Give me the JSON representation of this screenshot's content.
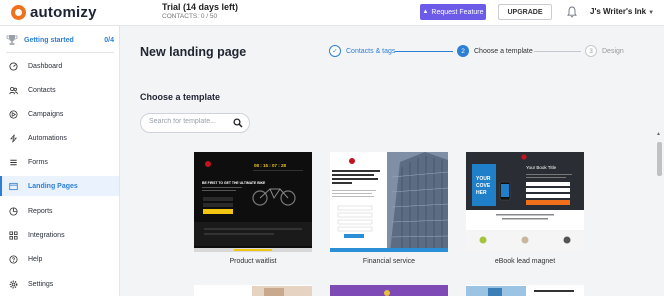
{
  "brand": {
    "name": "automizy"
  },
  "header": {
    "trial_title": "Trial (14 days left)",
    "trial_contacts": "CONTACTS: 0 / 50",
    "request_feature": "Request Feature",
    "upgrade": "UPGRADE",
    "account_name": "J's Writer's Ink"
  },
  "sidebar": {
    "getting_started": {
      "label": "Getting started",
      "count": "0/4"
    },
    "items": [
      {
        "label": "Dashboard",
        "icon": "dashboard-icon"
      },
      {
        "label": "Contacts",
        "icon": "contacts-icon"
      },
      {
        "label": "Campaigns",
        "icon": "campaigns-icon"
      },
      {
        "label": "Automations",
        "icon": "automations-icon"
      },
      {
        "label": "Forms",
        "icon": "forms-icon"
      },
      {
        "label": "Landing Pages",
        "icon": "landing-pages-icon",
        "active": true
      },
      {
        "label": "Reports",
        "icon": "reports-icon"
      },
      {
        "label": "Integrations",
        "icon": "integrations-icon"
      },
      {
        "label": "Help",
        "icon": "help-icon"
      },
      {
        "label": "Settings",
        "icon": "settings-icon"
      }
    ]
  },
  "main": {
    "page_title": "New landing page",
    "steps": [
      {
        "label": "Contacts & tags",
        "state": "done",
        "marker": "✓"
      },
      {
        "label": "Choose a template",
        "state": "current",
        "marker": "2"
      },
      {
        "label": "Design",
        "state": "upcoming",
        "marker": "3"
      }
    ],
    "section_title": "Choose a template",
    "search": {
      "placeholder": "Search for template...",
      "value": ""
    },
    "templates": [
      {
        "name": "Product waitlist",
        "preview": {
          "headline": "BE FIRST TO GET THE ULTIMATE BIKE",
          "countdown": [
            "08",
            "15",
            "07",
            "28"
          ]
        }
      },
      {
        "name": "Financial service",
        "preview": {
          "headline": "Smarter financial management for your business designed to help you grow"
        }
      },
      {
        "name": "eBook lead magnet",
        "preview": {
          "headline": "Your Book Title",
          "cover_text": "YOUR COVER HERE"
        }
      }
    ]
  },
  "colors": {
    "accent": "#2d7fd6",
    "request_button": "#6b5be8",
    "brand_orange": "#f0701c"
  }
}
